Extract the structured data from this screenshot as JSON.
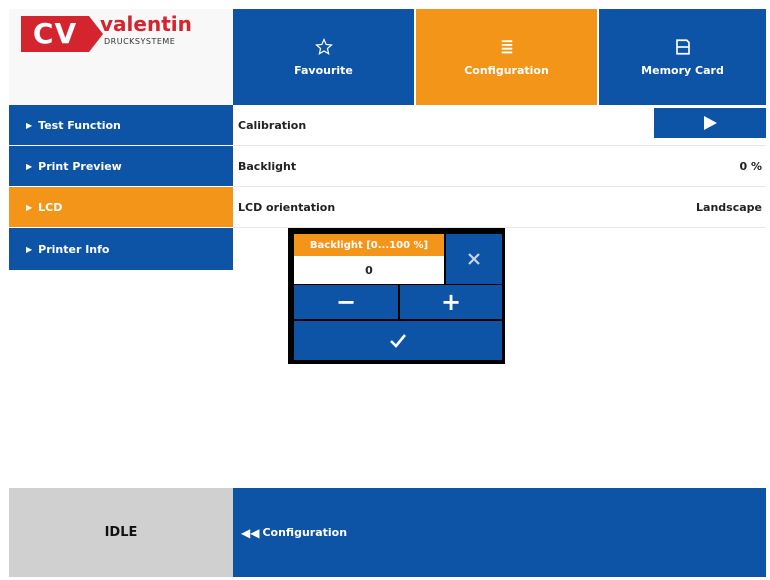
{
  "logo": {
    "mark": "CV",
    "name": "valentin",
    "subtitle": "DRUCKSYSTEME"
  },
  "tabs": [
    {
      "label": "Favourite",
      "icon": "star-icon"
    },
    {
      "label": "Configuration",
      "icon": "list-icon"
    },
    {
      "label": "Memory Card",
      "icon": "memory-card-icon"
    }
  ],
  "sidebar": {
    "items": [
      {
        "label": "Test Function"
      },
      {
        "label": "Print Preview"
      },
      {
        "label": "LCD"
      },
      {
        "label": "Printer Info"
      }
    ]
  },
  "settings": [
    {
      "label": "Calibration",
      "value": ""
    },
    {
      "label": "Backlight",
      "value": "0 %"
    },
    {
      "label": "LCD orientation",
      "value": "Landscape"
    }
  ],
  "dialog": {
    "title": "Backlight [0...100 %]",
    "value": "0",
    "minus": "−",
    "plus": "+"
  },
  "footer": {
    "status": "IDLE",
    "breadcrumb": "Configuration"
  },
  "colors": {
    "primary": "#0e54a6",
    "accent": "#f39519",
    "brand": "#d4252f"
  }
}
